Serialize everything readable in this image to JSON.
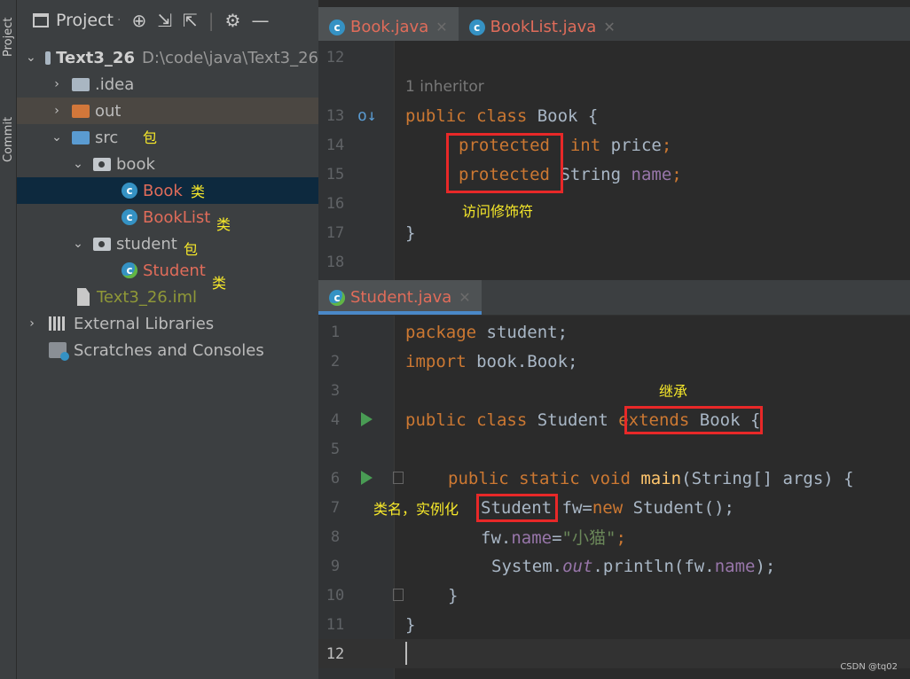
{
  "toolstrip": {
    "project_tab": "Project",
    "commit_tab": "Commit"
  },
  "project_panel": {
    "title": "Project",
    "root": {
      "name": "Text3_26",
      "path": "D:\\code\\java\\Text3_26"
    },
    "items": {
      "idea": ".idea",
      "out": "out",
      "src": "src",
      "book": "book",
      "book_class": "Book",
      "booklist_class": "BookList",
      "student_pkg": "student",
      "student_class": "Student",
      "iml": "Text3_26.iml",
      "ext_libs": "External Libraries",
      "scratches": "Scratches and Consoles"
    },
    "annotations": {
      "bao1": "包",
      "lei1": "类",
      "lei2": "类",
      "bao2": "包",
      "lei3": "类"
    }
  },
  "top_editor": {
    "tabs": [
      {
        "label": "Book.java",
        "active": true
      },
      {
        "label": "BookList.java",
        "active": false
      }
    ],
    "line_numbers": [
      "12",
      "13",
      "14",
      "15",
      "16",
      "17",
      "18"
    ],
    "inheritor_hint": "1 inheritor",
    "code": {
      "l13_kw": "public class",
      "l13_rest": " Book {",
      "l14_kw": "protected",
      "l14_type": "int",
      "l14_name": "price",
      "l14_semi": ";",
      "l15_kw": "protected",
      "l15_type": "String",
      "l15_name": "name",
      "l15_semi": ";",
      "l17": "}"
    },
    "annotation": "访问修饰符"
  },
  "bottom_editor": {
    "tab": "Student.java",
    "line_numbers": [
      "1",
      "2",
      "3",
      "4",
      "5",
      "6",
      "7",
      "8",
      "9",
      "10",
      "11",
      "12"
    ],
    "code": {
      "l1_kw": "package",
      "l1_rest": " student;",
      "l2_kw": "import",
      "l2_rest": " book.Book;",
      "l4_kw": "public class",
      "l4_name": " Student ",
      "l4_ext": "extends",
      "l4_book": " Book",
      "l4_end": " {",
      "l6_kw": "public static void",
      "l6_fn": "main",
      "l6_rest": "(String[] args) {",
      "l7_type": "Student",
      "l7_var": " fw=",
      "l7_new": "new",
      "l7_rest": " Student();",
      "l8_obj": "fw.",
      "l8_fld": "name",
      "l8_eq": "=",
      "l8_str": "\"小猫\"",
      "l8_semi": ";",
      "l9_a": "System.",
      "l9_out": "out",
      "l9_b": ".println(fw.",
      "l9_fld": "name",
      "l9_c": ");",
      "l10": "}",
      "l11": "}"
    },
    "annotations": {
      "inherit": "继承",
      "instantiate": "类名，实例化"
    }
  },
  "watermark": "CSDN @tq02"
}
